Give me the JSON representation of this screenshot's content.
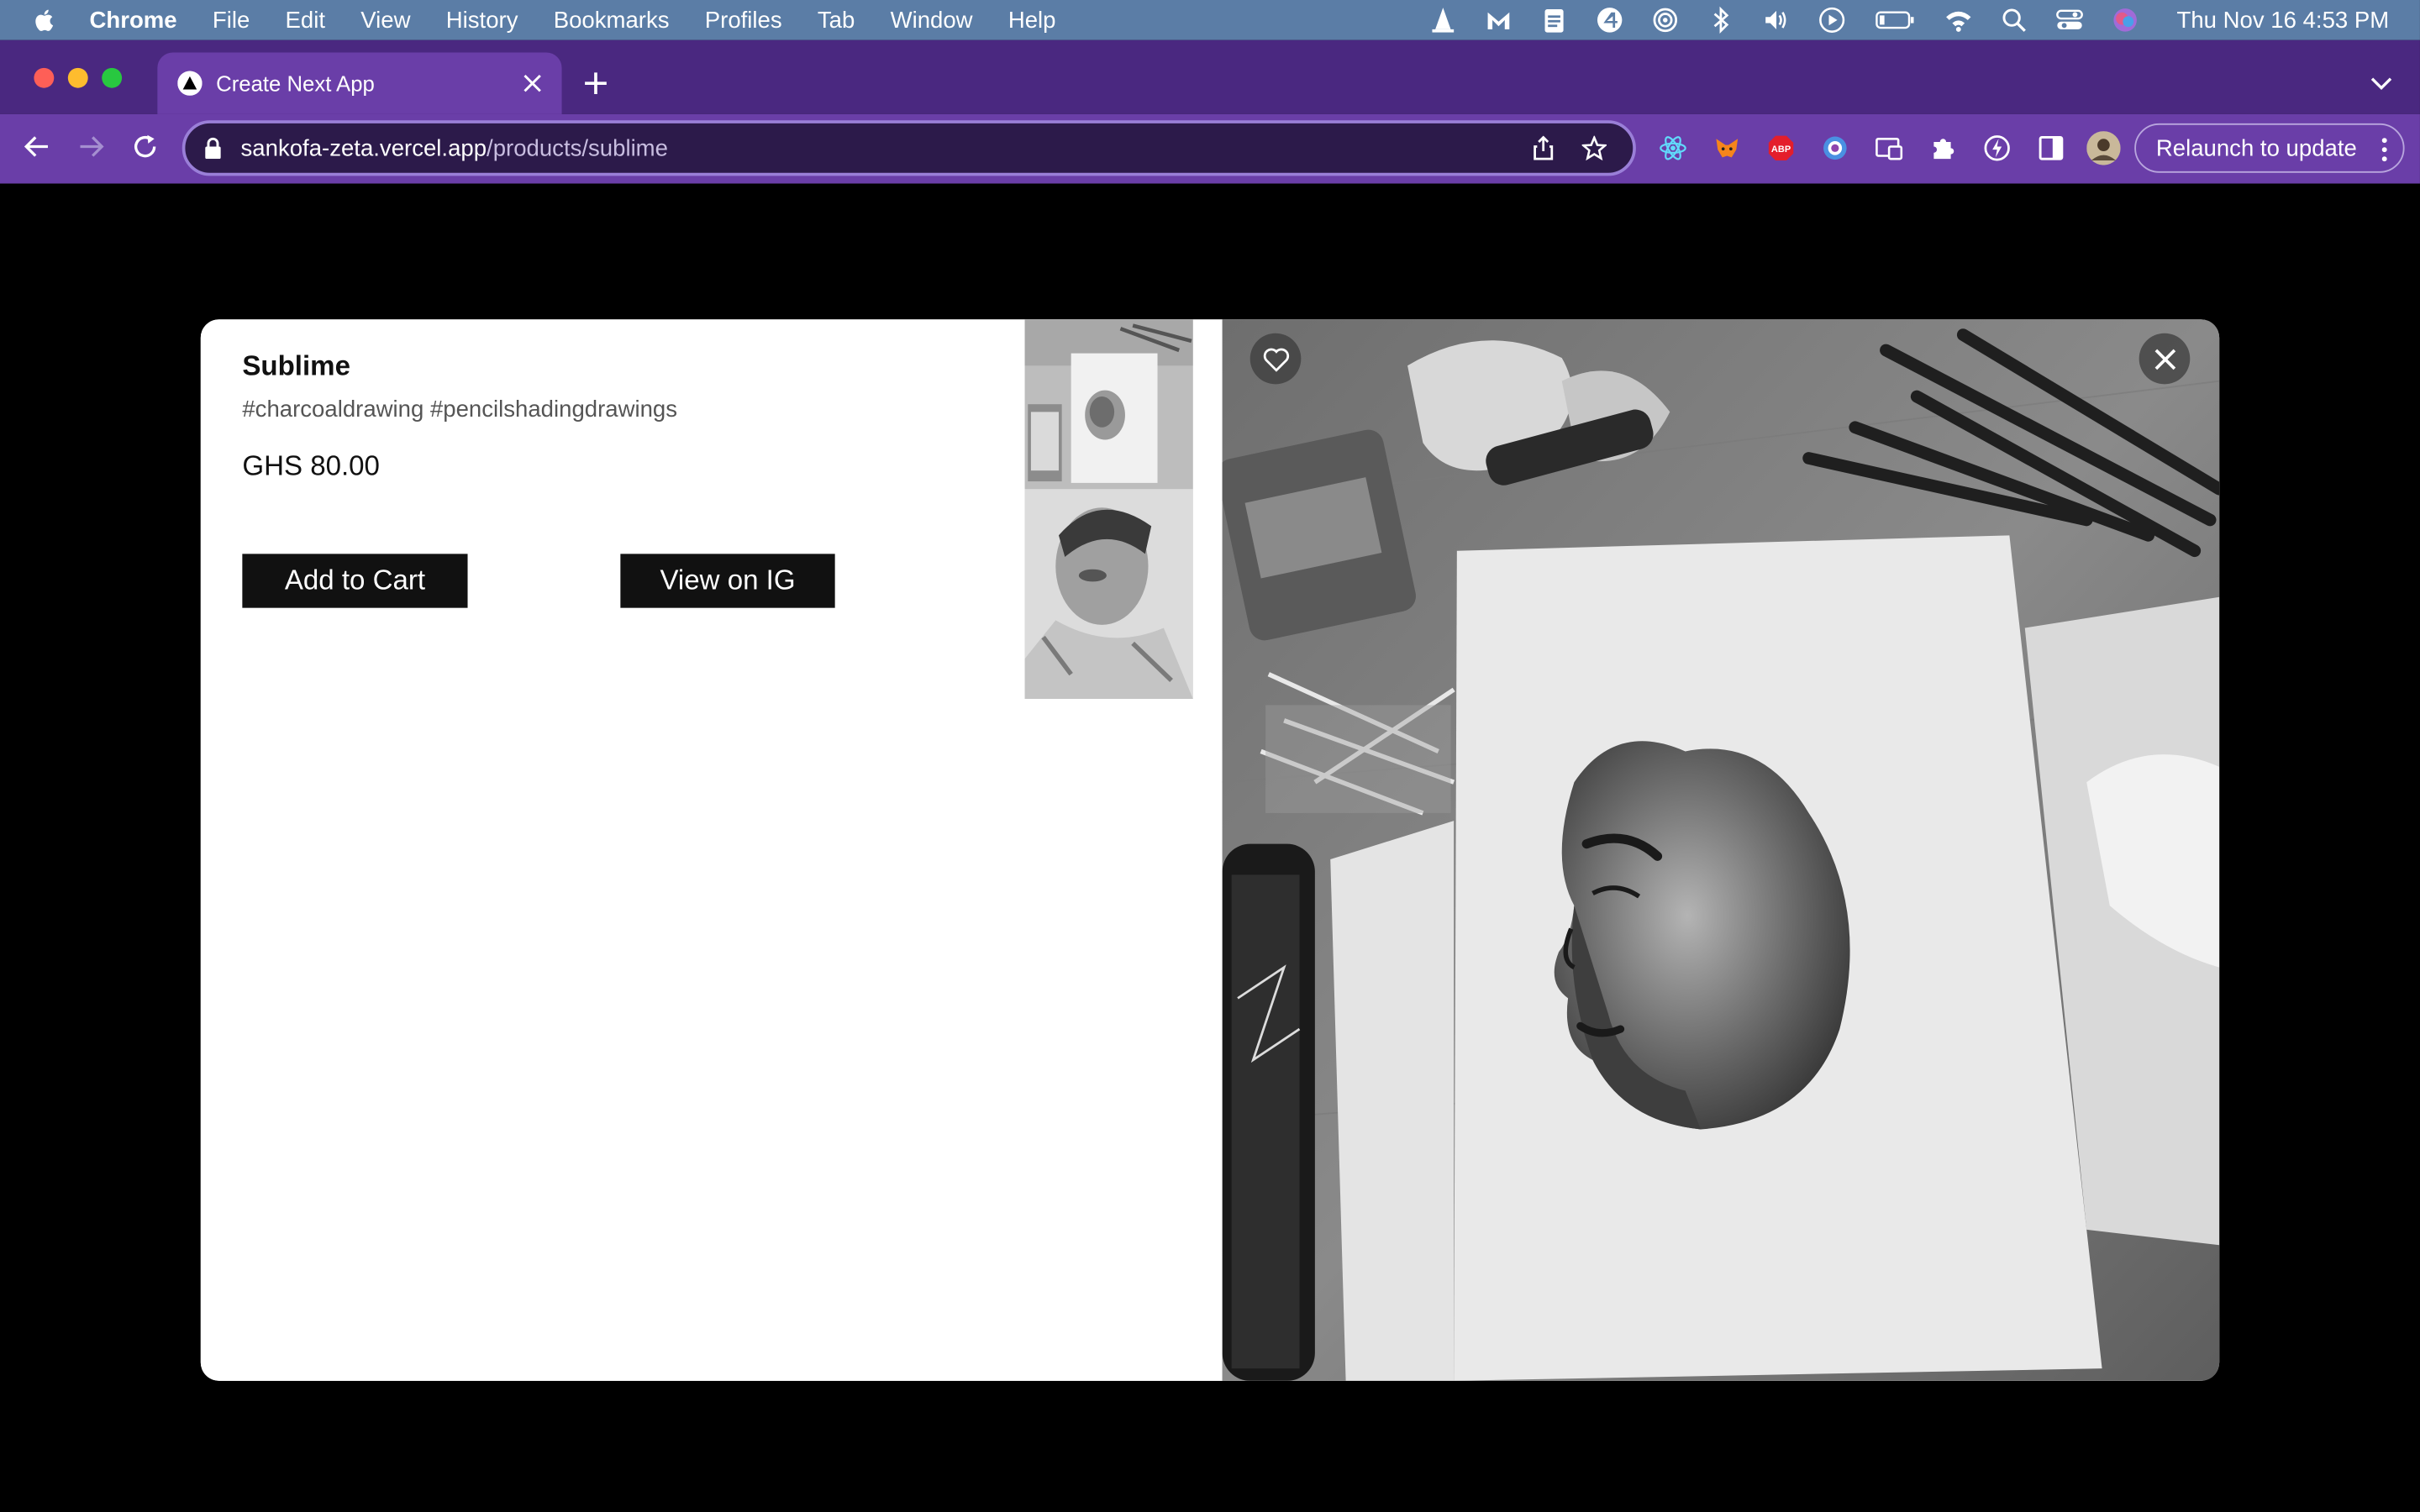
{
  "menubar": {
    "app_name": "Chrome",
    "items": [
      "File",
      "Edit",
      "View",
      "History",
      "Bookmarks",
      "Profiles",
      "Tab",
      "Window",
      "Help"
    ],
    "status_icons": [
      "vlc-icon",
      "malwarebytes-icon",
      "clipboard-icon",
      "app-4-icon",
      "airdrop-icon",
      "bluetooth-icon",
      "volume-icon",
      "play-icon",
      "battery-icon",
      "wifi-icon",
      "spotlight-icon",
      "control-center-icon",
      "siri-icon"
    ],
    "clock": "Thu Nov 16  4:53 PM"
  },
  "browser": {
    "tab_title": "Create Next App",
    "url_host": "sankofa-zeta.vercel.app",
    "url_path": "/products/sublime",
    "relaunch_label": "Relaunch to update",
    "extension_icons": [
      "react-devtools-icon",
      "metamask-icon",
      "adblock-plus-icon",
      "extension-circle-icon",
      "cast-icon",
      "extensions-puzzle-icon",
      "ai-extension-icon",
      "sidebar-icon",
      "profile-avatar-icon"
    ]
  },
  "product": {
    "title": "Sublime",
    "tags": "#charcoaldrawing #pencilshadingdrawings",
    "price": "GHS 80.00",
    "add_to_cart_label": "Add to Cart",
    "view_on_ig_label": "View on IG"
  },
  "colors": {
    "menubar_bg": "#5b7da6",
    "tabbar_bg": "#4a2880",
    "toolbar_bg": "#6a3ea8",
    "button_bg": "#111111",
    "page_bg": "#000000"
  }
}
